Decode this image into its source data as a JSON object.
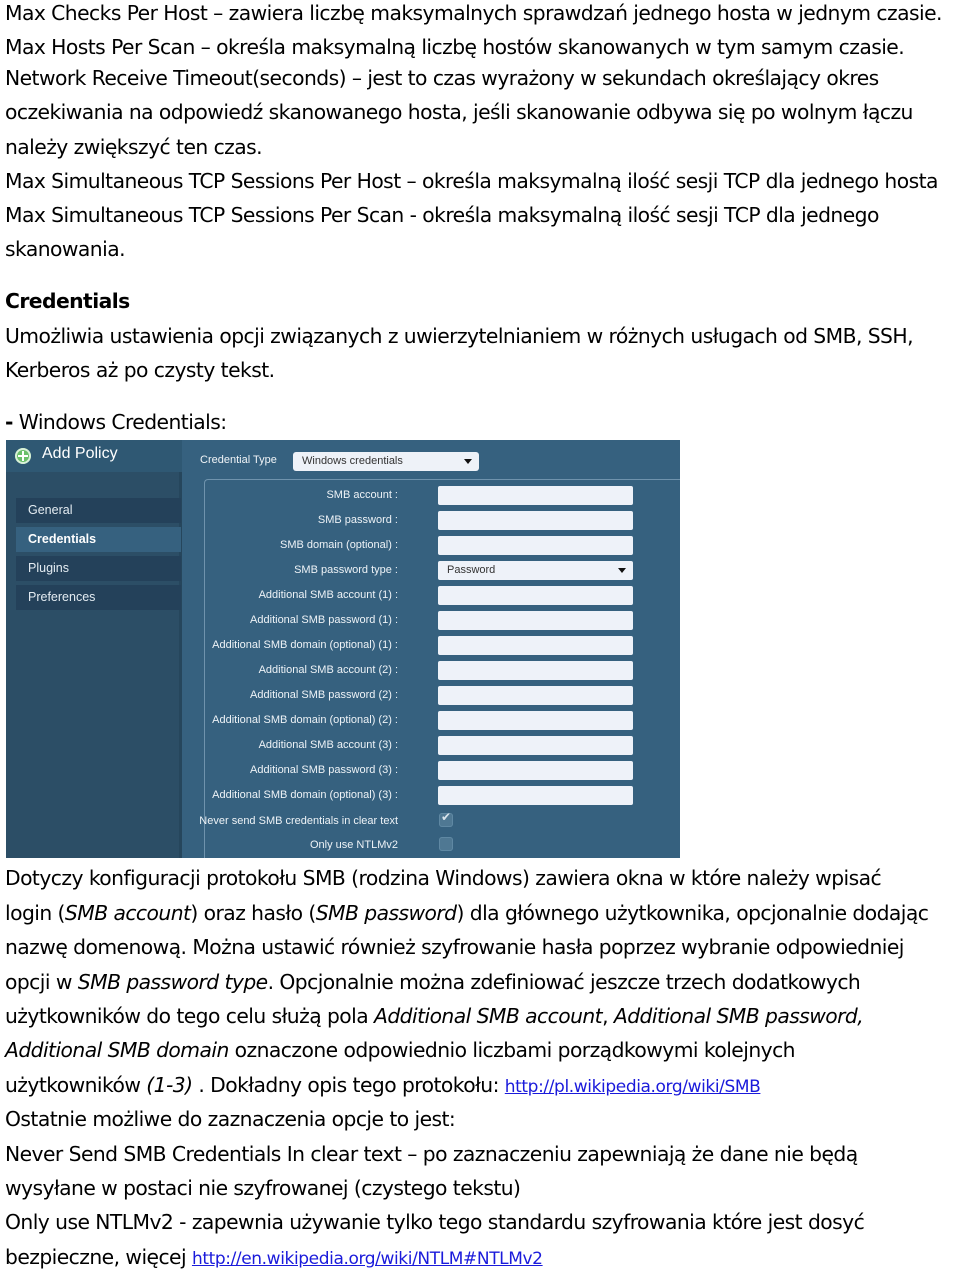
{
  "document": {
    "para1": [
      "Max Checks Per Host – zawiera liczbę maksymalnych sprawdzań jednego hosta w jednym czasie.",
      "Max Hosts Per Scan – określa maksymalną liczbę hostów skanowanych w tym samym czasie.",
      "Network Receive Timeout(seconds) – jest to czas wyrażony w sekundach określający okres",
      "oczekiwania na odpowiedź skanowanego hosta, jeśli skanowanie odbywa się po wolnym łączu",
      "należy zwiększyć ten czas.",
      "Max Simultaneous TCP Sessions Per Host – określa maksymalną ilość sesji TCP dla jednego hosta",
      "Max Simultaneous TCP Sessions Per Scan - określa maksymalną ilość sesji TCP dla jednego",
      "skanowania."
    ],
    "credentials_heading": "Credentials",
    "credentials_desc": [
      "Umożliwia ustawienia opcji związanych z uwierzytelnianiem w różnych usługach od SMB, SSH,",
      "Kerberos aż po czysty tekst."
    ],
    "windows_dash": "-",
    "windows_label": " Windows Credentials:",
    "para2": {
      "l1": "Dotyczy konfiguracji protokołu SMB  (rodzina Windows) zawiera okna w które należy wpisać",
      "l2a": "login (",
      "l2b": "SMB account",
      "l2c": ") oraz hasło (",
      "l2d": "SMB password",
      "l2e": ") dla głównego użytkownika, opcjonalnie dodając",
      "l3": "nazwę domenową. Można ustawić również szyfrowanie hasła poprzez wybranie odpowiedniej",
      "l4a": "opcji w ",
      "l4b": "SMB password type",
      "l4c": ". Opcjonalnie można zdefiniować jeszcze trzech dodatkowych",
      "l5a": "użytkowników do tego celu służą pola ",
      "l5b": "Additional SMB account",
      "l5c": ", ",
      "l5d": "Additional SMB password",
      "l5e": ",",
      "l6a": "Additional SMB domain",
      "l6b": " oznaczone odpowiednio liczbami porządkowymi kolejnych",
      "l7a": "użytkowników ",
      "l7b": "(1-3)",
      "l7c": " . Dokładny opis tego protokołu: ",
      "l7link": "http://pl.wikipedia.org/wiki/SMB"
    },
    "para3": {
      "l1": "Ostatnie możliwe do zaznaczenia opcje to jest:",
      "l2": "Never Send SMB Credentials In clear text – po zaznaczeniu zapewniają że dane nie będą",
      "l3": "wysyłane w postaci nie szyfrowanej (czystego tekstu)",
      "l4": "Only use NTLMv2 - zapewnia używanie tylko tego standardu szyfrowania które jest dosyć",
      "l5a": "bezpieczne, więcej ",
      "l5link": "http://en.wikipedia.org/wiki/NTLM#NTLMv2"
    }
  },
  "screenshot": {
    "title": "Add Policy",
    "title_icon": "add-circle-icon",
    "sidebar": [
      {
        "label": "General",
        "active": false
      },
      {
        "label": "Credentials",
        "active": true
      },
      {
        "label": "Plugins",
        "active": false
      },
      {
        "label": "Preferences",
        "active": false
      }
    ],
    "credential_type_label": "Credential Type",
    "credential_type_value": "Windows credentials",
    "fields": [
      {
        "label": "SMB account :",
        "value": ""
      },
      {
        "label": "SMB password :",
        "value": ""
      },
      {
        "label": "SMB domain (optional) :",
        "value": ""
      },
      {
        "label": "SMB password type :",
        "value": "Password",
        "type": "select"
      },
      {
        "label": "Additional SMB account (1) :",
        "value": ""
      },
      {
        "label": "Additional SMB password (1) :",
        "value": ""
      },
      {
        "label": "Additional SMB domain (optional) (1) :",
        "value": ""
      },
      {
        "label": "Additional SMB account (2) :",
        "value": ""
      },
      {
        "label": "Additional SMB password (2) :",
        "value": ""
      },
      {
        "label": "Additional SMB domain (optional) (2) :",
        "value": ""
      },
      {
        "label": "Additional SMB account (3) :",
        "value": ""
      },
      {
        "label": "Additional SMB password (3) :",
        "value": ""
      },
      {
        "label": "Additional SMB domain (optional) (3) :",
        "value": ""
      }
    ],
    "checkboxes": [
      {
        "label": "Never send SMB credentials in clear text",
        "checked": true
      },
      {
        "label": "Only use NTLMv2",
        "checked": false
      }
    ],
    "colors": {
      "panel_bg": "#36617f",
      "sidebar_bg": "#2c4e66",
      "sidebar_item_bg": "#24415a",
      "input_bg": "#eef2f9",
      "link": "#1a1adb"
    }
  }
}
